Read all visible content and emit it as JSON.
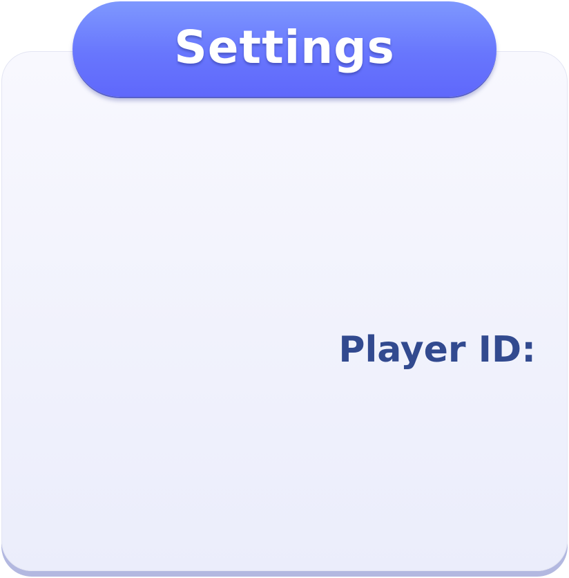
{
  "header": {
    "title": "Settings"
  },
  "panel": {
    "player_id_label": "Player ID:"
  },
  "colors": {
    "title_pill": "#6876fd",
    "panel_background": "#f3f4fd",
    "panel_shadow": "#b3b8e0",
    "label_text": "#324a8f"
  }
}
